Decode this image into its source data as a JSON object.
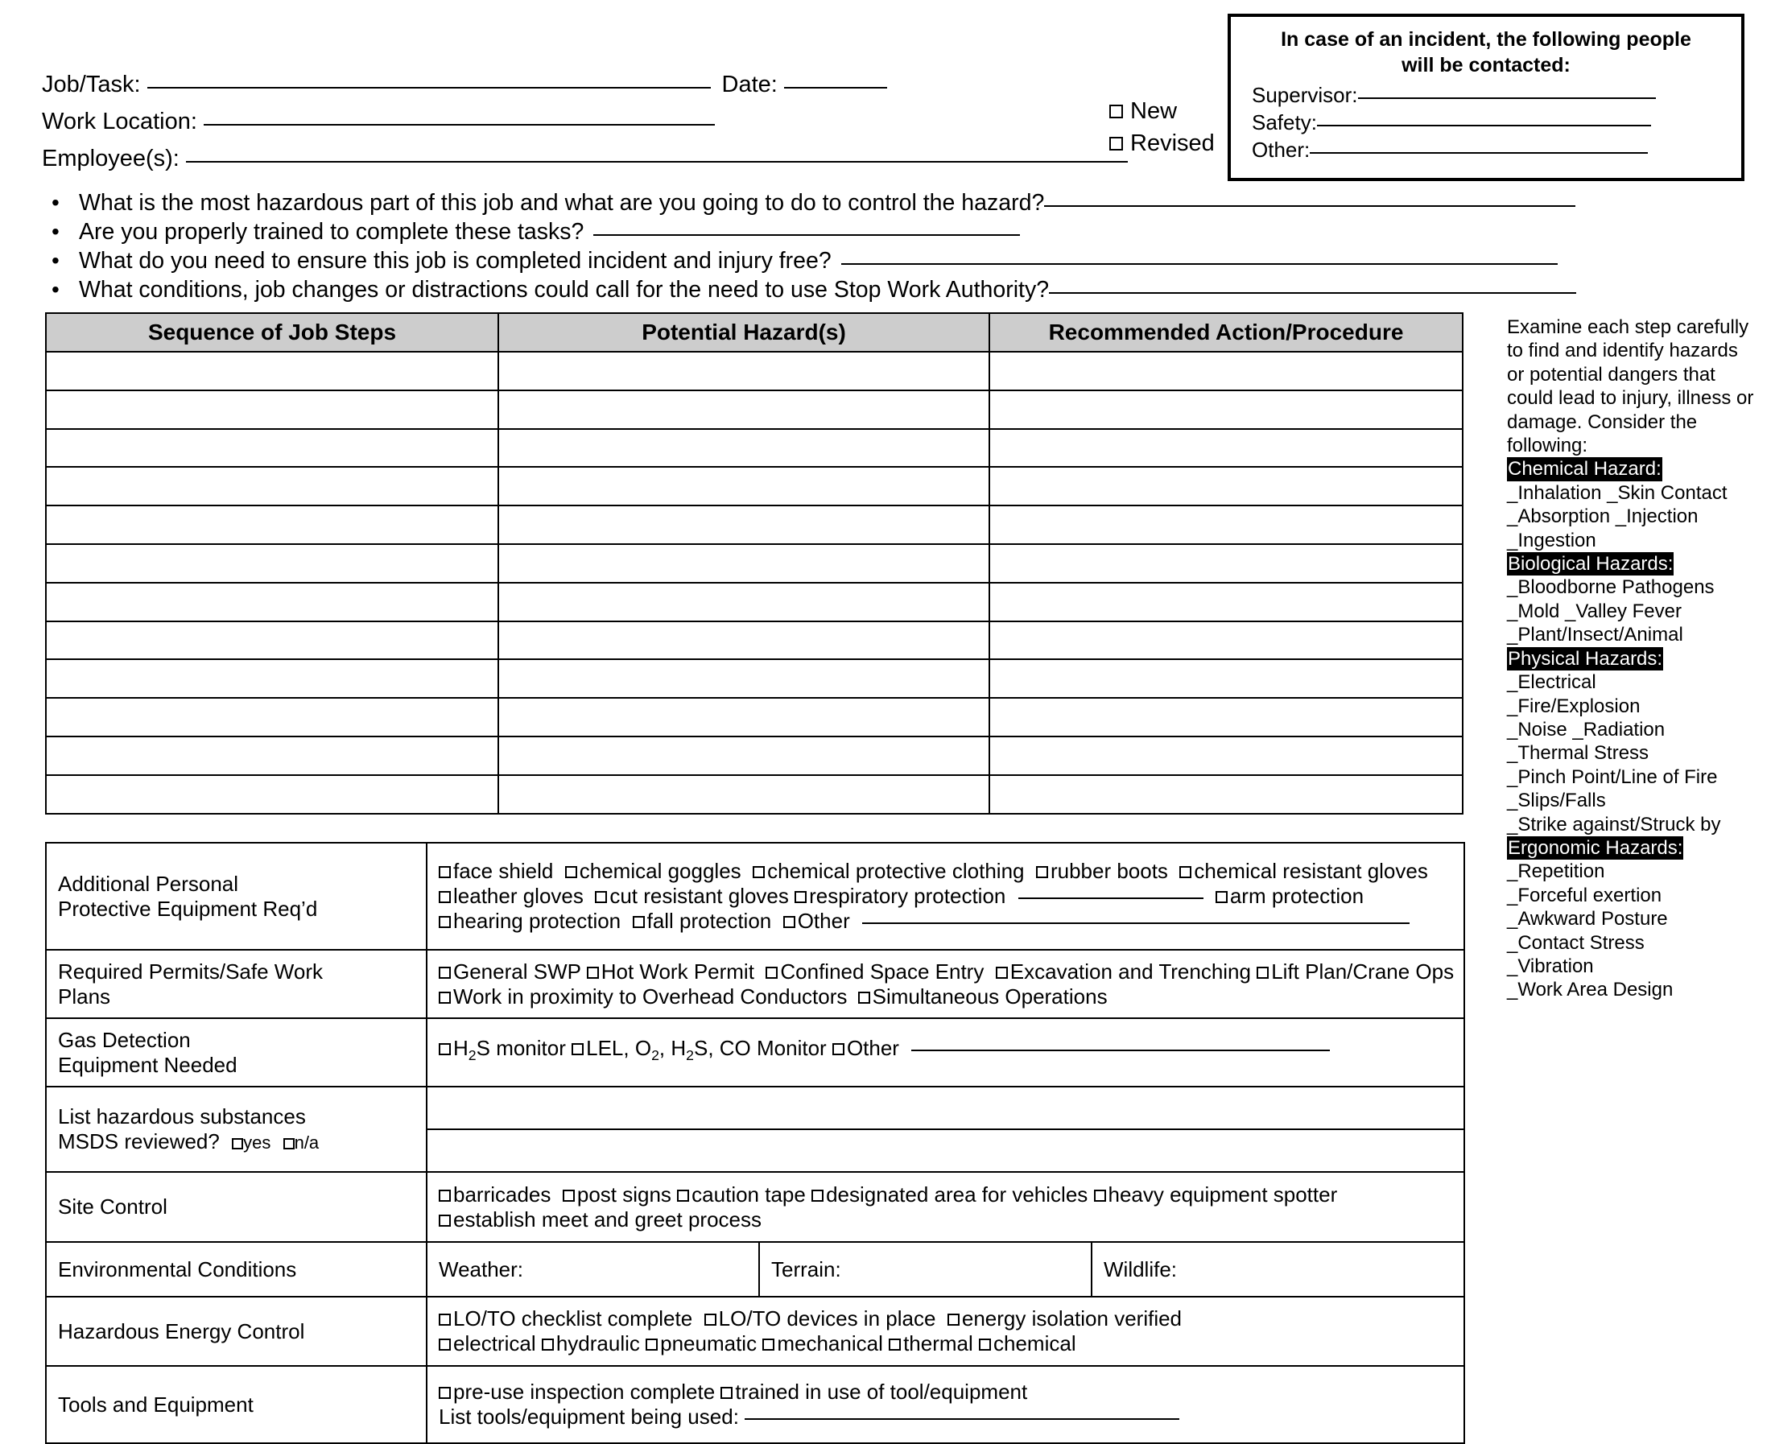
{
  "header": {
    "job_task_label": "Job/Task:",
    "date_label": "Date:",
    "work_location_label": "Work Location:",
    "employees_label": "Employee(s):",
    "new_label": "New",
    "revised_label": "Revised"
  },
  "incident_box": {
    "title_line1": "In case of an incident, the following people",
    "title_line2": "will be contacted:",
    "supervisor_label": "Supervisor:",
    "safety_label": "Safety:",
    "other_label": "Other:"
  },
  "questions": [
    {
      "bullet": "•",
      "text": "What is the most hazardous part of this job and what are you going to do to control the hazard?"
    },
    {
      "bullet": "•",
      "text": "Are you properly trained to complete these tasks?"
    },
    {
      "bullet": "•",
      "text": "What do you need to ensure this job is completed incident and injury free?"
    },
    {
      "bullet": "•",
      "text": "What conditions, job changes or distractions could call for the need to use Stop Work Authority?"
    }
  ],
  "main_table": {
    "columns": [
      "Sequence of Job Steps",
      "Potential Hazard(s)",
      "Recommended Action/Procedure"
    ],
    "row_count": 12
  },
  "sidebar": {
    "intro": "Examine each step carefully to find and identify hazards or potential dangers that could lead to injury, illness or damage. Consider the following:",
    "groups": [
      {
        "heading": "Chemical Hazard:",
        "items": [
          "_Inhalation _Skin Contact",
          "_Absorption _Injection",
          "_Ingestion"
        ]
      },
      {
        "heading": "Biological Hazards:",
        "items": [
          "_Bloodborne Pathogens",
          "_Mold _Valley Fever",
          "_Plant/Insect/Animal"
        ]
      },
      {
        "heading": "Physical Hazards:",
        "items": [
          "_Electrical",
          "_Fire/Explosion",
          "_Noise _Radiation",
          "_Thermal Stress",
          "_Pinch Point/Line of Fire",
          "_Slips/Falls",
          "_Strike against/Struck by"
        ]
      },
      {
        "heading": "Ergonomic Hazards:",
        "items": [
          "_Repetition",
          "_Forceful exertion",
          "_Awkward Posture",
          "_Contact Stress",
          "_Vibration",
          "_Work Area Design"
        ]
      }
    ]
  },
  "bottom_form": {
    "ppe": {
      "label_line1": "Additional Personal",
      "label_line2": "Protective Equipment Req’d",
      "row1": [
        "face shield",
        "chemical goggles",
        "chemical protective clothing",
        "rubber boots",
        "chemical resistant gloves"
      ],
      "row2": [
        "leather gloves",
        "cut resistant gloves",
        "respiratory protection",
        "arm protection"
      ],
      "row3": [
        "hearing protection",
        "fall protection",
        "Other"
      ]
    },
    "permits": {
      "label_line1": "Required Permits/Safe Work",
      "label_line2": "Plans",
      "row1": [
        "General SWP",
        "Hot Work Permit",
        "Confined Space Entry",
        "Excavation and Trenching",
        "Lift Plan/Crane Ops"
      ],
      "row2": [
        "Work in proximity to Overhead Conductors",
        "Simultaneous Operations"
      ]
    },
    "gas": {
      "label_line1": "Gas Detection",
      "label_line2": "Equipment Needed",
      "opt1_pre": "H",
      "opt1_sub": "2",
      "opt1_post": "S monitor",
      "opt2": "LEL, O₂, H₂S, CO Monitor",
      "opt3": "Other"
    },
    "msds": {
      "label_line1": "List hazardous substances",
      "label_line2": "MSDS reviewed?",
      "yes_label": "yes",
      "na_label": "n/a"
    },
    "site_control": {
      "label": "Site Control",
      "row1": [
        "barricades",
        "post signs",
        "caution tape",
        "designated area for vehicles",
        "heavy equipment spotter"
      ],
      "row2": [
        "establish meet and greet process"
      ]
    },
    "environmental": {
      "label": "Environmental Conditions",
      "weather_label": "Weather:",
      "terrain_label": "Terrain:",
      "wildlife_label": "Wildlife:"
    },
    "energy": {
      "label": "Hazardous Energy Control",
      "row1": [
        "LO/TO checklist complete",
        "LO/TO devices in place",
        "energy isolation verified"
      ],
      "row2": [
        "electrical",
        "hydraulic",
        "pneumatic",
        "mechanical",
        "thermal",
        "chemical"
      ]
    },
    "tools": {
      "label": "Tools and Equipment",
      "row1": [
        "pre-use inspection complete",
        "trained in use of tool/equipment"
      ],
      "row2_label": "List tools/equipment being used:"
    }
  }
}
